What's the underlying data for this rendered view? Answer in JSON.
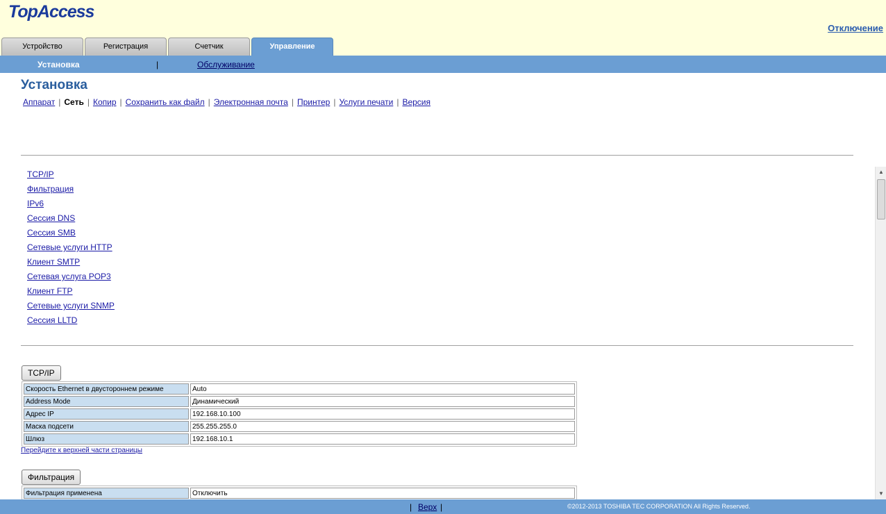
{
  "header": {
    "logo": "TopAccess",
    "logout": "Отключение"
  },
  "tabs": [
    {
      "label": "Устройство"
    },
    {
      "label": "Регистрация"
    },
    {
      "label": "Счетчик"
    },
    {
      "label": "Управление",
      "active": true
    }
  ],
  "subnav": {
    "current": "Установка",
    "separator": "|",
    "link": "Обслуживание"
  },
  "page_title": "Установка",
  "menu": {
    "items": [
      "Аппарат",
      "Сеть",
      "Копир",
      "Сохранить как файл",
      "Электронная почта",
      "Принтер",
      "Услуги печати",
      "Версия"
    ],
    "current": "Сеть"
  },
  "section_links": [
    "TCP/IP",
    "Фильтрация",
    "IPv6",
    "Сессия DNS",
    "Сессия SMB",
    "Сетевые услуги HTTP",
    "Клиент SMTP",
    "Сетевая услуга POP3",
    "Клиент FTP",
    "Сетевые услуги SNMP",
    "Сессия LLTD"
  ],
  "tcpip": {
    "button": "TCP/IP",
    "rows": [
      {
        "label": "Скорость Ethernet в двустороннем режиме",
        "value": "Auto"
      },
      {
        "label": "Address Mode",
        "value": "Динамический"
      },
      {
        "label": "Адрес IP",
        "value": "192.168.10.100"
      },
      {
        "label": "Маска подсети",
        "value": "255.255.255.0"
      },
      {
        "label": "Шлюз",
        "value": "192.168.10.1"
      }
    ],
    "top_link": "Перейдите к верхней части страницы"
  },
  "filtering": {
    "button": "Фильтрация",
    "rows": [
      {
        "label": "Фильтрация применена",
        "value": "Отключить"
      }
    ]
  },
  "footer": {
    "sep": "|",
    "top_link": "Верх",
    "copyright": "©2012-2013 TOSHIBA TEC CORPORATION All Rights Reserved."
  },
  "colors": {
    "header_bg": "#ffffdd",
    "nav_blue": "#6b9ed3",
    "title_blue": "#2a5e9e",
    "label_cell": "#c9def0"
  }
}
